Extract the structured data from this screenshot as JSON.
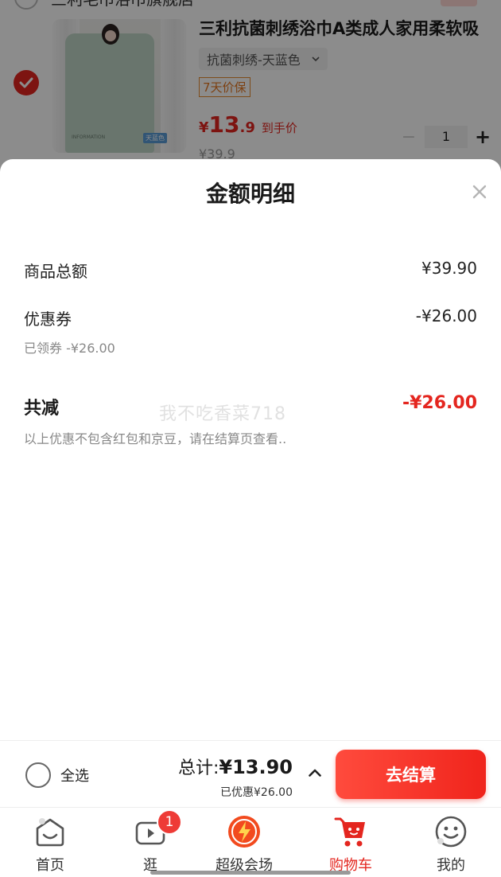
{
  "background_cart": {
    "prev_item_text": "三利毛巾浴巾旗舰店",
    "product": {
      "title": "三利抗菌刺绣浴巾A类成人家用柔软吸",
      "spec": "抗菌刺绣-天蓝色",
      "guarantee": "7天价保",
      "price_symbol": "¥",
      "price_int": "13",
      "price_dec": ".9",
      "price_label": "到手价",
      "original_price": "¥39.9",
      "quantity": "1",
      "image_tag": "天蓝色",
      "image_info": "INFORMATION"
    }
  },
  "sheet": {
    "title": "金额明细",
    "rows": [
      {
        "label": "商品总额",
        "value": "¥39.90"
      },
      {
        "label": "优惠券",
        "value": "-¥26.00",
        "sub": "已领券 -¥26.00"
      }
    ],
    "total_label": "共减",
    "total_value": "-¥26.00",
    "note": "以上优惠不包含红包和京豆，请在结算页查看..",
    "watermark": "我不吃香菜718"
  },
  "checkout": {
    "select_all_label": "全选",
    "total_label": "总计:",
    "total_value": "¥13.90",
    "discount_text": "已优惠¥26.00",
    "button_label": "去结算"
  },
  "tabbar": {
    "items": [
      {
        "label": "首页",
        "icon": "home-icon",
        "active": false
      },
      {
        "label": "逛",
        "icon": "video-icon",
        "active": false,
        "badge": "1"
      },
      {
        "label": "超级会场",
        "icon": "super-venue-icon",
        "active": false
      },
      {
        "label": "购物车",
        "icon": "cart-icon",
        "active": true
      },
      {
        "label": "我的",
        "icon": "profile-icon",
        "active": false
      }
    ]
  },
  "colors": {
    "accent": "#e4261f",
    "guarantee": "#e37722"
  }
}
